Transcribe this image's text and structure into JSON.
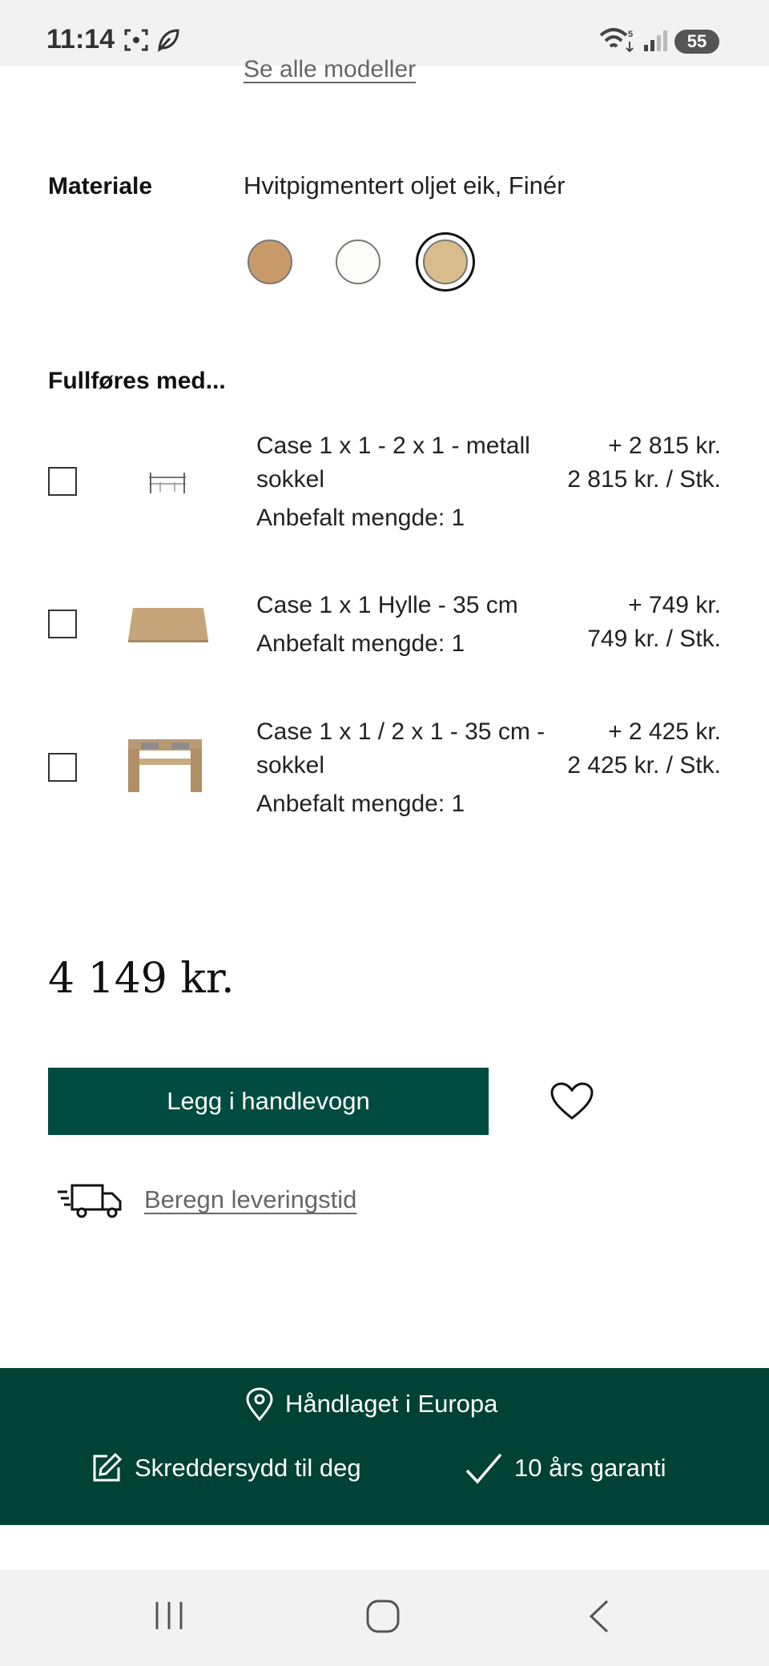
{
  "status_bar": {
    "time": "11:14",
    "battery": "55"
  },
  "top_link": "Se alle modeller",
  "material": {
    "label": "Materiale",
    "value": "Hvitpigmentert oljet eik, Finér",
    "swatches": [
      {
        "color": "#c89a6a",
        "selected": false
      },
      {
        "color": "#fbfbf9",
        "selected": false
      },
      {
        "color": "#d9bc8e",
        "selected": true
      }
    ]
  },
  "addons": {
    "title": "Fullføres med...",
    "items": [
      {
        "name": "Case 1 x 1 - 2 x 1 - metall sokkel",
        "recommended": "Anbefalt mengde: 1",
        "price_add": "+ 2 815 kr.",
        "unit_price": "2 815 kr. / Stk.",
        "thumb": "metal-base"
      },
      {
        "name": "Case 1 x 1 Hylle - 35 cm",
        "recommended": "Anbefalt mengde: 1",
        "price_add": "+ 749 kr.",
        "unit_price": "749 kr. / Stk.",
        "thumb": "wood-shelf"
      },
      {
        "name": "Case 1 x 1 / 2 x 1 - 35 cm - sokkel",
        "recommended": "Anbefalt mengde: 1",
        "price_add": "+ 2 425 kr.",
        "unit_price": "2 425 kr. / Stk.",
        "thumb": "wood-base"
      }
    ]
  },
  "total_price": "4 149 kr.",
  "cart_button": "Legg i handlevogn",
  "delivery_link": "Beregn leveringstid",
  "footer": {
    "made_in": "Håndlaget i Europa",
    "tailored": "Skreddersydd til deg",
    "warranty": "10 års garanti"
  },
  "colors": {
    "brand_green": "#004c40",
    "footer_green": "#004236"
  }
}
